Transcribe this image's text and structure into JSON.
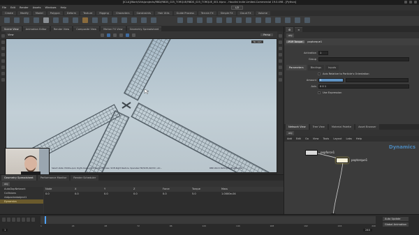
{
  "window": {
    "title": "[ICLA]/Work/Vids/projects/RBD/RBDS_025_TORQUE/RBDS_025_TORQUE_001.hipnc - Houdini Indie Limited-Commercial 19.0.498 - [Python]"
  },
  "menubar": {
    "items": [
      "File",
      "Edit",
      "Render",
      "Assets",
      "Windows",
      "Help"
    ],
    "desktop": "LJ3"
  },
  "shelf": {
    "tabs": [
      "Create",
      "Modify",
      "Model",
      "Polygon",
      "Deform",
      "Texture",
      "Rigging",
      "Characters",
      "Constraints",
      "Hair Utils",
      "Guide Process",
      "Terrain FX",
      "Simple FX",
      "Cloud FX",
      "Volume"
    ]
  },
  "viewport": {
    "tabs": [
      "Scene View",
      "Animation Editor",
      "Render View",
      "Composite View",
      "Motion FX View",
      "Geometry Spreadsheet"
    ],
    "path": "obj",
    "view_label": "View",
    "camera_label": "Persp",
    "no_cam": "No cam",
    "status_text": "Select state: Middle-quiz, Right-down, Click-Center/Fit view, Shift-Right Restore, Spacebar-Tilt/Shift-/Alt/Ctrl, etc...",
    "watermark": "RBD World Parting Parting/Bundle"
  },
  "params": {
    "path": "obj",
    "node_type": "POP Torque",
    "node_name": "poptorque1",
    "rows": [
      {
        "label": "Activation",
        "value": "1"
      },
      {
        "label": "Group",
        "value": ""
      }
    ],
    "tabs": [
      "Parameters",
      "Bindings",
      "Inputs"
    ],
    "sub_label": "Axis Relative to Particle's Orientation",
    "torque_rows": [
      {
        "label": "Amount",
        "value": "5"
      },
      {
        "label": "Axis",
        "value": "0  0  1"
      }
    ],
    "checkbox_label": "Use Expression"
  },
  "network": {
    "tabs": [
      "Network View",
      "Tree View",
      "Material Palette",
      "Asset Browser"
    ],
    "path": "obj",
    "menu": [
      "Add",
      "Edit",
      "Go",
      "View",
      "Tools",
      "Layout",
      "Labs",
      "Help"
    ],
    "context_label": "Dynamics",
    "nodes": [
      {
        "name": "popforce1"
      },
      {
        "name": "poptorque1"
      },
      {
        "name": "PRESOLVE"
      }
    ]
  },
  "dop_pane": {
    "tabs": [
      "Geometry Spreadsheet",
      "Performance Monitor",
      "Render Scheduler"
    ],
    "tree": [
      "AutoDopNetwork",
      "Collisions",
      "rbdpackedobject1",
      "Dynamics"
    ],
    "columns": [
      "Node",
      "X",
      "Y",
      "Z",
      "Force",
      "Torque",
      "Mass"
    ],
    "values": [
      "0.0",
      "0.0",
      "0.0",
      "0.0",
      "0.0",
      "5.0",
      "1.0000e-04"
    ]
  },
  "timeline": {
    "frame": "1",
    "ticks": [
      "1",
      "24",
      "48",
      "72",
      "96",
      "120",
      "144",
      "168",
      "192",
      "216",
      "240"
    ],
    "buttons": [
      "Auto Update",
      "Global Animation"
    ],
    "end_frame": "240"
  },
  "colors": {
    "accent": "#4fa3ff",
    "selection": "#5f93c4",
    "dynamics_label": "#4b86b8",
    "presolve_node": "#c96a2a"
  }
}
